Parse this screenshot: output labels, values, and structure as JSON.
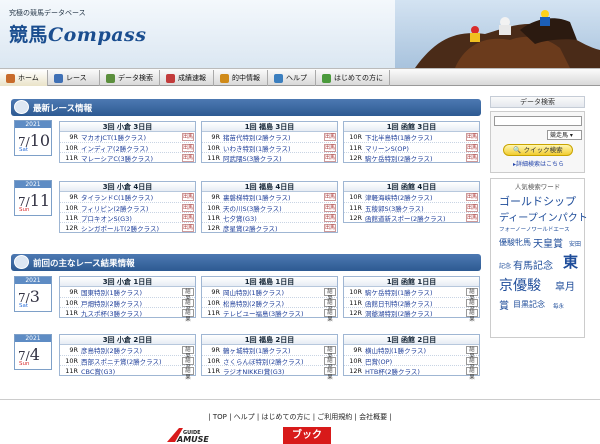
{
  "header": {
    "tagline": "究極の競馬データベース",
    "logo_ja": "競馬",
    "logo_en": "Compass"
  },
  "nav": [
    {
      "label": "ホーム",
      "icon": "home-icon",
      "color": "#c86b2b"
    },
    {
      "label": "レース",
      "icon": "race-icon",
      "color": "#3f70b5"
    },
    {
      "label": "データ検索",
      "icon": "search-icon",
      "color": "#5b8f3d"
    },
    {
      "label": "成績速報",
      "icon": "results-icon",
      "color": "#c23b3b"
    },
    {
      "label": "的中情報",
      "icon": "hit-icon",
      "color": "#d08b1a"
    },
    {
      "label": "ヘルプ",
      "icon": "help-icon",
      "color": "#3b7fbf"
    },
    {
      "label": "はじめての方に",
      "icon": "beginner-icon",
      "color": "#4a9a3c"
    }
  ],
  "latest": {
    "title": "最新レース情報",
    "days": [
      {
        "year": "2021",
        "month": "7",
        "day": "10",
        "dow": "Sat",
        "cards": [
          {
            "venue": "3回 小倉 3日目",
            "tag": "出馬",
            "rows": [
              {
                "no": "9R",
                "name": "マカオJCT(1勝クラス)"
              },
              {
                "no": "10R",
                "name": "インディア(2勝クラス)"
              },
              {
                "no": "11R",
                "name": "マレーシアC(3勝クラス)"
              }
            ]
          },
          {
            "venue": "1回 福島 3日目",
            "tag": "出馬",
            "rows": [
              {
                "no": "9R",
                "name": "猪苗代特別(2勝クラス)"
              },
              {
                "no": "10R",
                "name": "いわき特別(1勝クラス)"
              },
              {
                "no": "11R",
                "name": "阿武隈S(3勝クラス)"
              }
            ]
          },
          {
            "venue": "1回 函館 3日目",
            "tag": "出馬",
            "rows": [
              {
                "no": "10R",
                "name": "下北半島特(1勝クラス)"
              },
              {
                "no": "11R",
                "name": "マリーンS(OP)"
              },
              {
                "no": "12R",
                "name": "駒ケ岳特別(2勝クラス)"
              }
            ]
          }
        ]
      },
      {
        "year": "2021",
        "month": "7",
        "day": "11",
        "dow": "Sun",
        "cards": [
          {
            "venue": "3回 小倉 4日目",
            "tag": "出馬",
            "rows": [
              {
                "no": "9R",
                "name": "タイランドC(1勝クラス)"
              },
              {
                "no": "10R",
                "name": "フィリピン(2勝クラス)"
              },
              {
                "no": "11R",
                "name": "プロキオンS(G3)"
              },
              {
                "no": "12R",
                "name": "シンガポールT(2勝クラス)"
              }
            ]
          },
          {
            "venue": "1回 福島 4日目",
            "tag": "出馬",
            "rows": [
              {
                "no": "9R",
                "name": "裏磐梯特別(1勝クラス)"
              },
              {
                "no": "10R",
                "name": "天の川S(3勝クラス)"
              },
              {
                "no": "11R",
                "name": "七夕賞(G3)"
              },
              {
                "no": "12R",
                "name": "彦星賞(2勝クラス)"
              }
            ]
          },
          {
            "venue": "1回 函館 4日目",
            "tag": "出馬",
            "rows": [
              {
                "no": "10R",
                "name": "津軽海峡特(2勝クラス)"
              },
              {
                "no": "11R",
                "name": "五稜郭S(3勝クラス)"
              },
              {
                "no": "12R",
                "name": "函館道新スポー(2勝クラス)"
              }
            ]
          }
        ]
      }
    ]
  },
  "previous": {
    "title": "前回の主なレース結果情報",
    "days": [
      {
        "year": "2021",
        "month": "7",
        "day": "3",
        "dow": "Sat",
        "cards": [
          {
            "venue": "3回 小倉 1日目",
            "tag": "結果",
            "rows": [
              {
                "no": "9R",
                "name": "国東特別(1勝クラス)"
              },
              {
                "no": "10R",
                "name": "戸畑特別(2勝クラス)"
              },
              {
                "no": "11R",
                "name": "九スポ杯(3勝クラス)"
              }
            ]
          },
          {
            "venue": "1回 福島 1日目",
            "tag": "結果",
            "rows": [
              {
                "no": "9R",
                "name": "岡山特別(1勝クラス)"
              },
              {
                "no": "10R",
                "name": "松島特別(2勝クラス)"
              },
              {
                "no": "11R",
                "name": "テレビユー福島(3勝クラス)"
              }
            ]
          },
          {
            "venue": "1回 函館 1日目",
            "tag": "結果",
            "rows": [
              {
                "no": "10R",
                "name": "駒ケ岳特別(1勝クラス)"
              },
              {
                "no": "11R",
                "name": "函館日刊特(2勝クラス)"
              },
              {
                "no": "12R",
                "name": "洞爺湖特別(2勝クラス)"
              }
            ]
          }
        ]
      },
      {
        "year": "2021",
        "month": "7",
        "day": "4",
        "dow": "Sun",
        "cards": [
          {
            "venue": "3回 小倉 2日目",
            "tag": "結果",
            "rows": [
              {
                "no": "9R",
                "name": "彦島特別(2勝クラス)"
              },
              {
                "no": "10R",
                "name": "西部スポニチ賞(2勝クラス)"
              },
              {
                "no": "11R",
                "name": "CBC賞(G3)"
              }
            ]
          },
          {
            "venue": "1回 福島 2日目",
            "tag": "結果",
            "rows": [
              {
                "no": "9R",
                "name": "鶴ヶ城特別(1勝クラス)"
              },
              {
                "no": "10R",
                "name": "さくらんぼ特別(2勝クラス)"
              },
              {
                "no": "11R",
                "name": "ラジオNIKKEI賞(G3)"
              }
            ]
          },
          {
            "venue": "1回 函館 2日目",
            "tag": "結果",
            "rows": [
              {
                "no": "9R",
                "name": "横山特別(1勝クラス)"
              },
              {
                "no": "10R",
                "name": "巴賞(OP)"
              },
              {
                "no": "12R",
                "name": "HTB杯(2勝クラス)"
              }
            ]
          }
        ]
      }
    ]
  },
  "search": {
    "title": "データ検索",
    "input_value": "",
    "select_value": "競走馬",
    "button_label": "クイック検索",
    "help_link": "詳細検索はこちら"
  },
  "popular": {
    "title": "人気検索ワード",
    "words": [
      "ゴールドシップ",
      "ディープインパクト",
      "フォーノーノワールドエース",
      "優駿牝馬",
      "天皇賞",
      "安田",
      "記念",
      "有馬記念",
      "東",
      "京優駿",
      "皐月",
      "賞",
      "目黒記念",
      "毎永"
    ]
  },
  "footer": {
    "links": "| TOP | ヘルプ | はじめての方に | ご利用規約 | 会社概要 |",
    "logo1": "AMUSE GUIDE",
    "logo2": "ブック"
  },
  "colors": {
    "accent": "#2d5a92",
    "link": "#1f3f9a"
  }
}
